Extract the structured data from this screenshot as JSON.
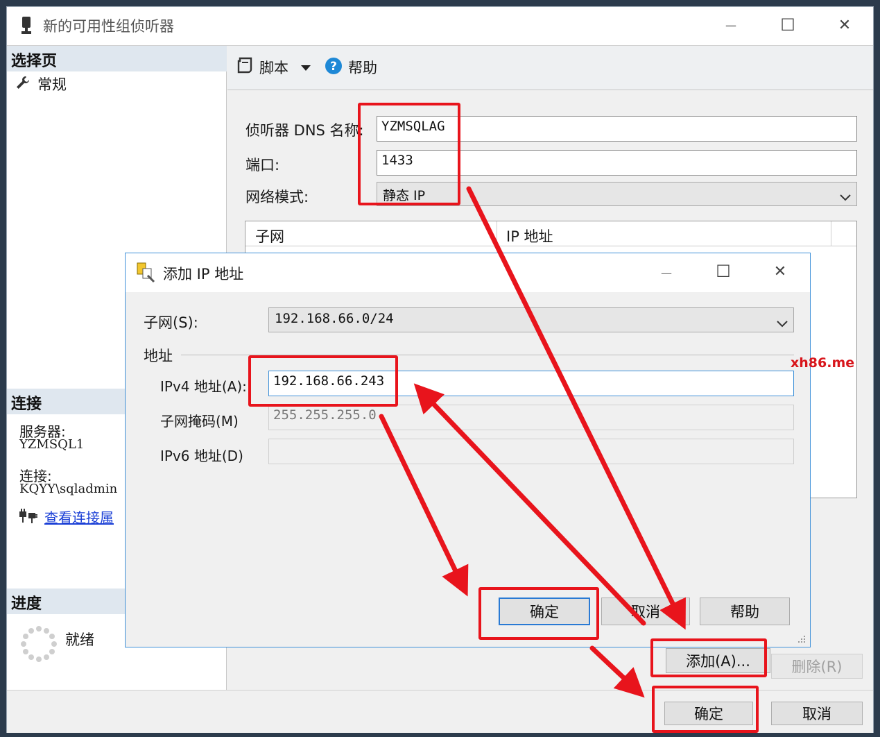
{
  "main_window": {
    "title": "新的可用性组侦听器",
    "controls": {
      "minimize": "—",
      "maximize": "☐",
      "close": "✕"
    }
  },
  "left_pane": {
    "select_page_header": "选择页",
    "general_item": "常规",
    "connect_header": "连接",
    "server_label": "服务器:",
    "server_value": "YZMSQL1",
    "connection_label": "连接:",
    "connection_value": "KQYY\\sqladmin",
    "view_connection_link": "查看连接属",
    "progress_header": "进度",
    "progress_status": "就绪"
  },
  "toolbar": {
    "script_label": "脚本",
    "help_label": "帮助"
  },
  "form": {
    "dns_label": "侦听器 DNS 名称:",
    "dns_value": "YZMSQLAG",
    "port_label": "端口:",
    "port_value": "1433",
    "network_mode_label": "网络模式:",
    "network_mode_value": "静态 IP",
    "table_headers": [
      "子网",
      "IP 地址"
    ],
    "add_button": "添加(A)...",
    "remove_button": "删除(R)",
    "ok_button": "确定",
    "cancel_button": "取消"
  },
  "add_ip_dialog": {
    "title": "添加 IP 地址",
    "controls": {
      "minimize": "—",
      "maximize": "☐",
      "close": "✕"
    },
    "subnet_label": "子网(S):",
    "subnet_value": "192.168.66.0/24",
    "address_group": "地址",
    "ipv4_label": "IPv4 地址(A):",
    "ipv4_value": "192.168.66.243",
    "mask_label": "子网掩码(M)",
    "mask_value": "255.255.255.0",
    "ipv6_label": "IPv6 地址(D)",
    "ipv6_value": "",
    "ok_button": "确定",
    "cancel_button": "取消",
    "help_button": "帮助"
  },
  "watermark": "xh86.me",
  "colors": {
    "annotation_red": "#e8141c",
    "accent_blue": "#2a7ad4",
    "link_blue": "#1a3fd6"
  }
}
